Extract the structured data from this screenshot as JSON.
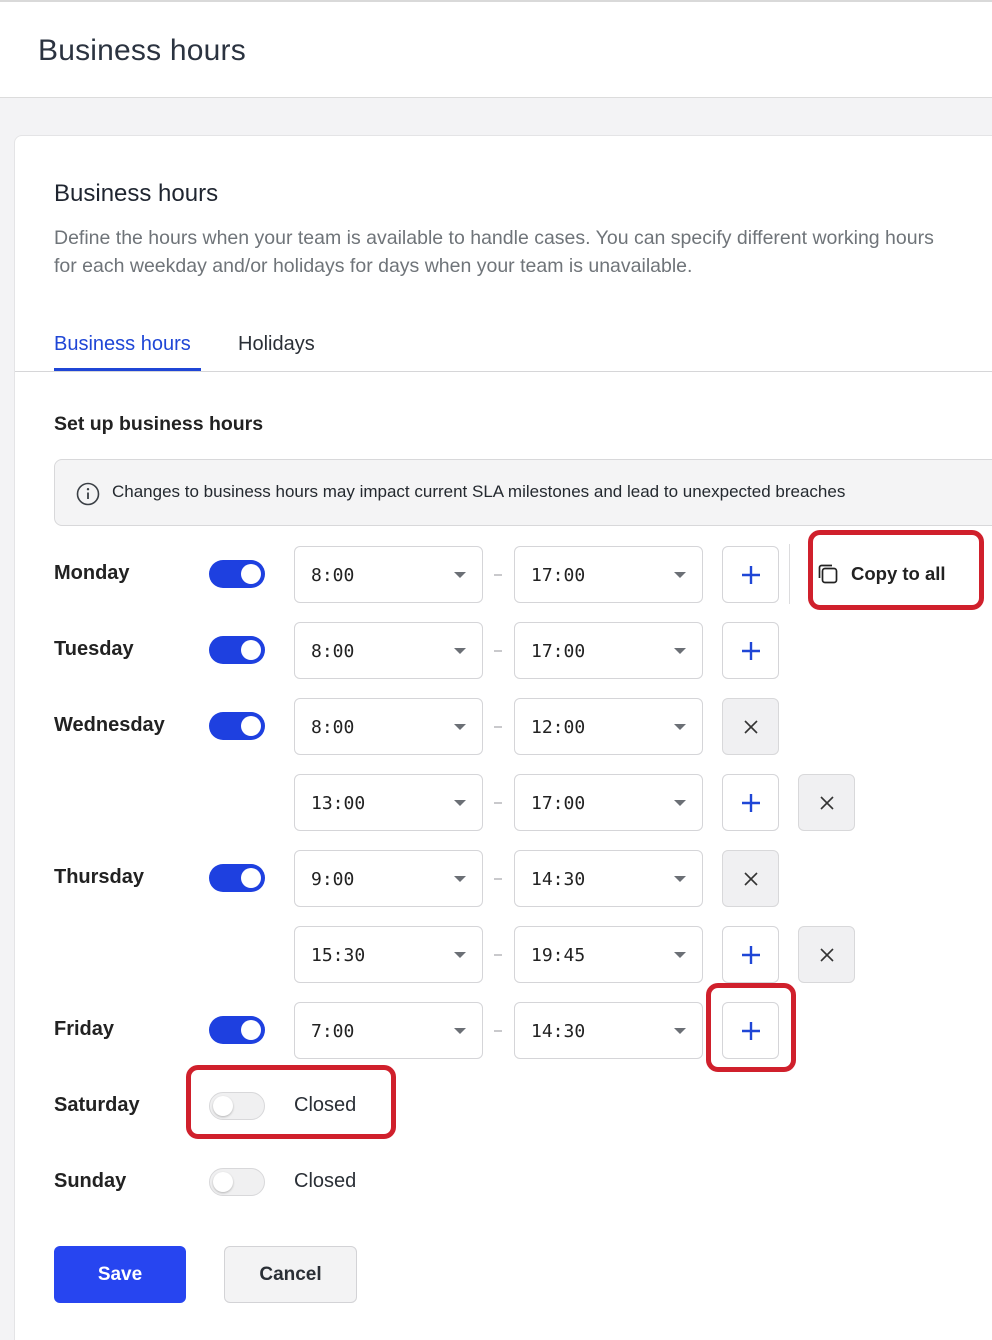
{
  "page": {
    "title": "Business hours"
  },
  "card": {
    "title": "Business hours",
    "description": "Define the hours when your team is available to handle cases. You can specify different working hours for each weekday and/or holidays for days when your team is unavailable."
  },
  "tabs": [
    {
      "label": "Business hours",
      "active": true
    },
    {
      "label": "Holidays",
      "active": false
    }
  ],
  "section_title": "Set up business hours",
  "notice": {
    "text": "Changes to business hours may impact current SLA milestones and lead to unexpected breaches",
    "icon": "info-icon"
  },
  "copy_to_all_label": "Copy to all",
  "closed_label": "Closed",
  "days": [
    {
      "name": "Monday",
      "enabled": true,
      "ranges": [
        {
          "start": "8:00",
          "end": "17:00"
        }
      ]
    },
    {
      "name": "Tuesday",
      "enabled": true,
      "ranges": [
        {
          "start": "8:00",
          "end": "17:00"
        }
      ]
    },
    {
      "name": "Wednesday",
      "enabled": true,
      "ranges": [
        {
          "start": "8:00",
          "end": "12:00"
        },
        {
          "start": "13:00",
          "end": "17:00"
        }
      ]
    },
    {
      "name": "Thursday",
      "enabled": true,
      "ranges": [
        {
          "start": "9:00",
          "end": "14:30"
        },
        {
          "start": "15:30",
          "end": "19:45"
        }
      ]
    },
    {
      "name": "Friday",
      "enabled": true,
      "ranges": [
        {
          "start": "7:00",
          "end": "14:30"
        }
      ]
    },
    {
      "name": "Saturday",
      "enabled": false,
      "ranges": []
    },
    {
      "name": "Sunday",
      "enabled": false,
      "ranges": []
    }
  ],
  "actions": {
    "save_label": "Save",
    "cancel_label": "Cancel"
  },
  "colors": {
    "accent": "#1f46d6",
    "toggle_on": "#1e40e0",
    "save_button": "#2745f0",
    "highlight": "#d0202c"
  }
}
